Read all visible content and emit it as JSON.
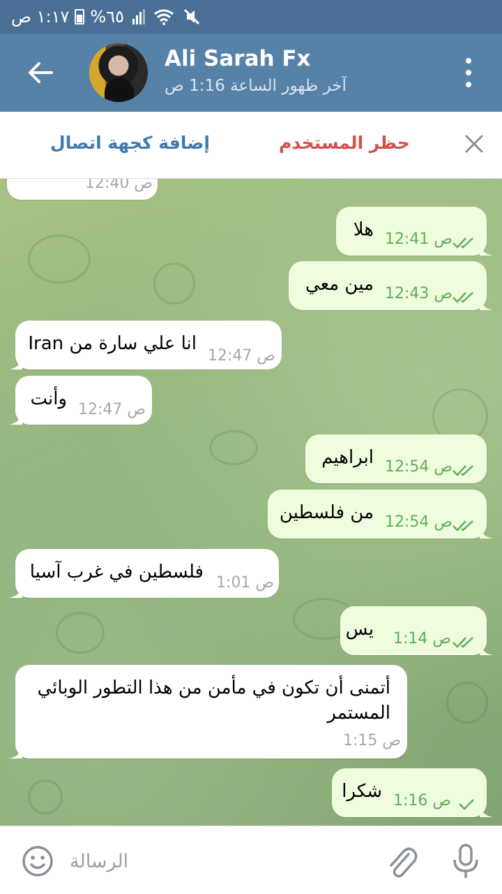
{
  "status_bar": {
    "time": "١:١٧ ص",
    "battery": "%٦٥"
  },
  "header": {
    "name": "Ali Sarah Fx",
    "last_seen": "آخر ظهور الساعة 1:16 ص"
  },
  "action_bar": {
    "add_contact_label": "إضافة كجهة اتصال",
    "block_user_label": "حظر المستخدم"
  },
  "messages": [
    {
      "dir": "in",
      "text": "...",
      "time": "12:40 ص"
    },
    {
      "dir": "out",
      "text": "هلا",
      "time": "12:41 ص",
      "status": "read"
    },
    {
      "dir": "out",
      "text": "مين معي",
      "time": "12:43 ص",
      "status": "read"
    },
    {
      "dir": "in",
      "text": "انا علي سارة من Iran",
      "time": "12:47 ص"
    },
    {
      "dir": "in",
      "text": "وأنت",
      "time": "12:47 ص"
    },
    {
      "dir": "out",
      "text": "ابراهيم",
      "time": "12:54 ص",
      "status": "read"
    },
    {
      "dir": "out",
      "text": "من فلسطين",
      "time": "12:54 ص",
      "status": "read"
    },
    {
      "dir": "in",
      "text": "فلسطين في غرب آسيا",
      "time": "1:01 ص"
    },
    {
      "dir": "out",
      "text": "يس",
      "time": "1:14 ص",
      "status": "read"
    },
    {
      "dir": "in",
      "text_line1": "أتمنى أن تكون في مأمن من هذا التطور الوبائي",
      "text_line2": "المستمر",
      "time": "1:15 ص"
    },
    {
      "dir": "out",
      "text": "شكرا",
      "time": "1:16 ص",
      "status": "sent"
    }
  ],
  "input": {
    "placeholder": "الرسالة"
  },
  "colors": {
    "status_bar": "#4a6f94",
    "header": "#5682a8",
    "out_bubble": "#effdde",
    "in_bubble": "#ffffff",
    "check": "#5fae58",
    "block": "#d2524b",
    "add_contact": "#3f7bb0"
  },
  "icons": [
    "back-arrow-icon",
    "more-vertical-icon",
    "close-icon",
    "double-check-icon",
    "single-check-icon",
    "emoji-icon",
    "attach-icon",
    "mic-icon"
  ]
}
